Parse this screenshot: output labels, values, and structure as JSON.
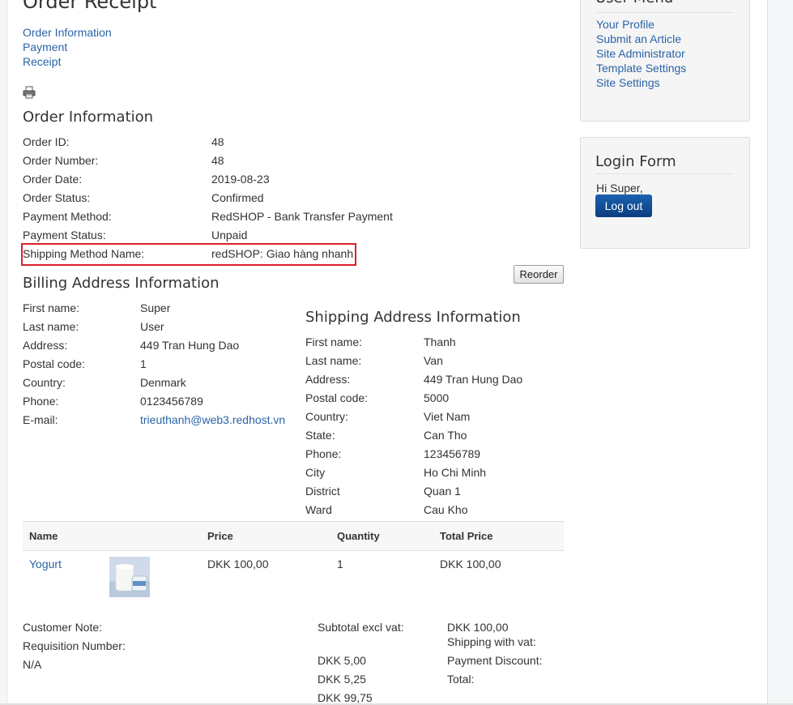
{
  "page": {
    "title": "Order Receipt"
  },
  "top_links": [
    "Order Information",
    "Payment",
    "Receipt"
  ],
  "order_info": {
    "heading": "Order Information",
    "rows": [
      {
        "label": "Order ID:",
        "value": "48"
      },
      {
        "label": "Order Number:",
        "value": "48"
      },
      {
        "label": "Order Date:",
        "value": "2019-08-23"
      },
      {
        "label": "Order Status:",
        "value": "Confirmed"
      },
      {
        "label": "Payment Method:",
        "value": "RedSHOP - Bank Transfer Payment"
      },
      {
        "label": "Payment Status:",
        "value": "Unpaid"
      },
      {
        "label": "Shipping Method Name:",
        "value": "redSHOP: Giao hàng nhanh"
      }
    ]
  },
  "reorder_label": "Reorder",
  "billing": {
    "heading": "Billing Address Information",
    "rows": [
      {
        "label": "First name:",
        "value": "Super"
      },
      {
        "label": "Last name:",
        "value": "User"
      },
      {
        "label": "Address:",
        "value": "449 Tran Hung Dao"
      },
      {
        "label": "Postal code:",
        "value": "1"
      },
      {
        "label": "Country:",
        "value": "Denmark"
      },
      {
        "label": "Phone:",
        "value": "0123456789"
      },
      {
        "label": "E-mail:",
        "value": "trieuthanh@web3.redhost.vn"
      }
    ]
  },
  "shipping": {
    "heading": "Shipping Address Information",
    "rows": [
      {
        "label": "First name:",
        "value": "Thanh"
      },
      {
        "label": "Last name:",
        "value": "Van"
      },
      {
        "label": "Address:",
        "value": "449 Tran Hung Dao"
      },
      {
        "label": "Postal code:",
        "value": "5000"
      },
      {
        "label": "Country:",
        "value": "Viet Nam"
      },
      {
        "label": "State:",
        "value": "Can Tho"
      },
      {
        "label": "Phone:",
        "value": "123456789"
      },
      {
        "label": "City",
        "value": "Ho Chi Minh"
      },
      {
        "label": "District",
        "value": "Quan 1"
      },
      {
        "label": "Ward",
        "value": "Cau Kho"
      }
    ]
  },
  "items_table": {
    "headers": [
      "Name",
      "Price",
      "Quantity",
      "Total Price"
    ],
    "rows": [
      {
        "name": "Yogurt",
        "price": "DKK 100,00",
        "quantity": "1",
        "total": "DKK 100,00"
      }
    ]
  },
  "notes": {
    "customer_note_label": "Customer Note:",
    "requisition_label": "Requisition Number:",
    "requisition_value": "N/A"
  },
  "totals": {
    "subtotal_label": "Subtotal excl vat:",
    "subtotal_value": "DKK 100,00",
    "shipping_label": "Shipping with vat:",
    "shipping_value": "DKK 5,00",
    "payment_discount_label": "Payment Discount:",
    "payment_discount_value": "DKK 5,25",
    "total_label": "Total:",
    "total_value": "DKK 99,75"
  },
  "sidebar": {
    "user_menu": {
      "heading": "User Menu",
      "items": [
        "Your Profile",
        "Submit an Article",
        "Site Administrator",
        "Template Settings",
        "Site Settings"
      ]
    },
    "login_form": {
      "heading": "Login Form",
      "greeting": "Hi Super,",
      "logout_label": "Log out"
    }
  }
}
